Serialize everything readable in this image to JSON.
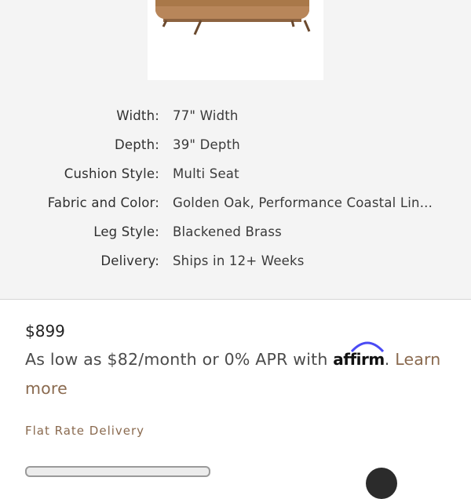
{
  "product": {
    "image_icon": "sofa-product-image"
  },
  "specs": [
    {
      "label": "Width:",
      "value": "77\" Width"
    },
    {
      "label": "Depth:",
      "value": "39\" Depth"
    },
    {
      "label": "Cushion Style:",
      "value": "Multi Seat"
    },
    {
      "label": "Fabric and Color:",
      "value": "Golden Oak, Performance Coastal Lin..."
    },
    {
      "label": "Leg Style:",
      "value": "Blackened Brass"
    },
    {
      "label": "Delivery:",
      "value": "Ships in 12+ Weeks"
    }
  ],
  "pricing": {
    "price": "$899",
    "financing_prefix": "As low as $82/month or 0% APR with ",
    "affirm_brand": "affirm",
    "financing_suffix": ". ",
    "learn_more": "Learn more"
  },
  "delivery": {
    "flat_rate": "Flat Rate Delivery"
  },
  "colors": {
    "panel_bg": "#f4f4f4",
    "accent": "#8a6a4f",
    "affirm_blue": "#4a4af4",
    "sofa": "#b8865a"
  }
}
